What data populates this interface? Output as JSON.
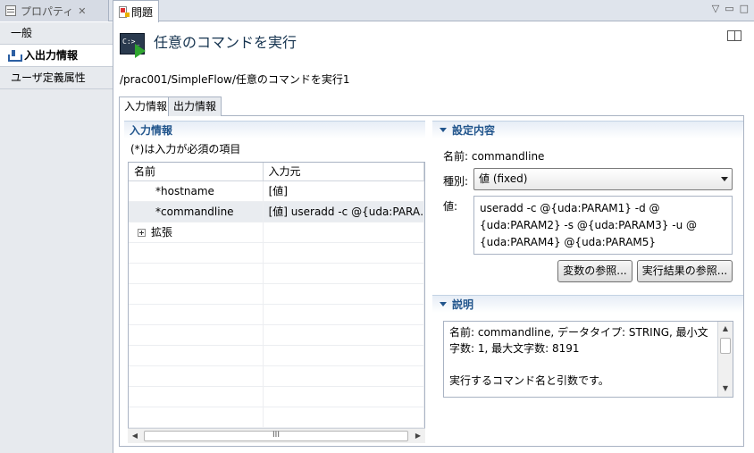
{
  "tabs": [
    {
      "label": "プロパティ",
      "icon": "properties-icon"
    },
    {
      "label": "問題",
      "icon": "problems-icon"
    }
  ],
  "view_menu": {
    "menu": "▽",
    "minimize": "▭",
    "maximize": "□"
  },
  "nav": {
    "items": [
      {
        "label": "一般"
      },
      {
        "label": "入出力情報",
        "icon": "input-output-icon",
        "selected": true
      },
      {
        "label": "ユーザ定義属性"
      }
    ]
  },
  "header": {
    "icon_text": "C:>_",
    "title": "任意のコマンドを実行",
    "path": "/prac001/SimpleFlow/任意のコマンドを実行1"
  },
  "inner_tabs": [
    {
      "label": "入力情報",
      "active": true
    },
    {
      "label": "出力情報",
      "active": false
    }
  ],
  "input_section": {
    "title": "入力情報",
    "note": "(*)は入力が必須の項目",
    "columns": [
      "名前",
      "入力元"
    ],
    "rows": [
      {
        "name": "*hostname",
        "source": "[値]"
      },
      {
        "name": "*commandline",
        "source": "[値] useradd -c @{uda:PARA…",
        "selected": true
      },
      {
        "name": "拡張",
        "source": "",
        "expandable": true
      }
    ],
    "scroll_thumb": "III"
  },
  "settings_section": {
    "title": "設定内容",
    "name_label": "名前:",
    "name_value": "commandline",
    "type_label": "種別:",
    "type_value": "値 (fixed)",
    "value_label": "値:",
    "value_text": "useradd -c @{uda:PARAM1} -d @\n{uda:PARAM2} -s @{uda:PARAM3} -u @\n{uda:PARAM4} @{uda:PARAM5}",
    "btn_var": "変数の参照...",
    "btn_result": "実行結果の参照..."
  },
  "description_section": {
    "title": "説明",
    "text": "名前: commandline, データタイプ: STRING, 最小文\n字数: 1, 最大文字数: 8191\n\n実行するコマンド名と引数です。"
  }
}
